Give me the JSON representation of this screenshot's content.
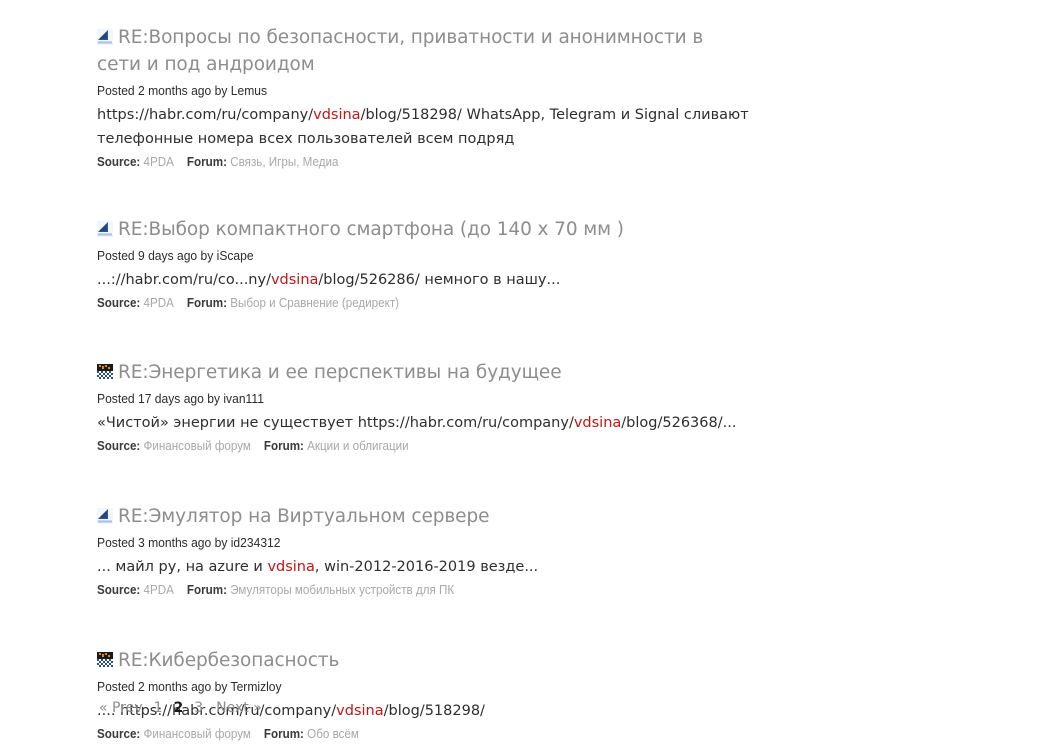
{
  "page": {
    "background": "#ffffff",
    "title_color": "#8d8d8d",
    "highlight_color": "#c01616",
    "body_color": "#2e2e2e",
    "meta_color": "#a8a8a8"
  },
  "labels": {
    "source_label": "Source:",
    "forum_label": "Forum:"
  },
  "results": [
    {
      "icon": "4pda-favicon",
      "title": "RE:Вопросы по безопасности, приватности и анонимности в сети и под андроидом",
      "posted": "Posted 2 months ago by Lemus",
      "snippet_pre": "https://habr.com/ru/company/",
      "snippet_highlight": "vdsina",
      "snippet_post": "/blog/518298/ WhatsApp, Telegram и Signal сливают телефонные номера всех пользователей всем подряд",
      "source": "4PDA",
      "forum": "Связь, Игры, Медиа"
    },
    {
      "icon": "4pda-favicon",
      "title": "RE:Выбор компактного смартфона (до 140 x 70 мм )",
      "posted": "Posted 9 days ago by iScape",
      "snippet_pre": "...://habr.com/ru/co...ny/",
      "snippet_highlight": "vdsina",
      "snippet_post": "/blog/526286/ немного в нашу...",
      "source": "4PDA",
      "forum": "Выбор и Сравнение (редирект)"
    },
    {
      "icon": "finforum-favicon",
      "title": "RE:Энергетика и ее перспективы на будущее",
      "posted": "Posted 17 days ago by ivan111",
      "snippet_pre": "«Чистой» энергии не существует https://habr.com/ru/company/",
      "snippet_highlight": "vdsina",
      "snippet_post": "/blog/526368/...",
      "source": "Финансовый форум",
      "forum": "Акции и облигации"
    },
    {
      "icon": "4pda-favicon",
      "title": "RE:Эмулятор на Виртуальном сервере",
      "posted": "Posted 3 months ago by id234312",
      "snippet_pre": "... майл ру, на azure и ",
      "snippet_highlight": "vdsina",
      "snippet_post": ", win-2012-2016-2019 везде...",
      "source": "4PDA",
      "forum": "Эмуляторы мобильных устройств для ПК"
    },
    {
      "icon": "finforum-favicon",
      "title": "RE:Кибербезопасность",
      "posted": "Posted 2 months ago by Termizloy",
      "snippet_pre": ".... https://habr.com/ru/company/",
      "snippet_highlight": "vdsina",
      "snippet_post": "/blog/518298/",
      "source": "Финансовый форум",
      "forum": "Обо всём"
    }
  ],
  "pagination": {
    "prev": "« Prev",
    "pages": [
      "1",
      "2",
      "3"
    ],
    "current": "2",
    "next": "Next »"
  }
}
